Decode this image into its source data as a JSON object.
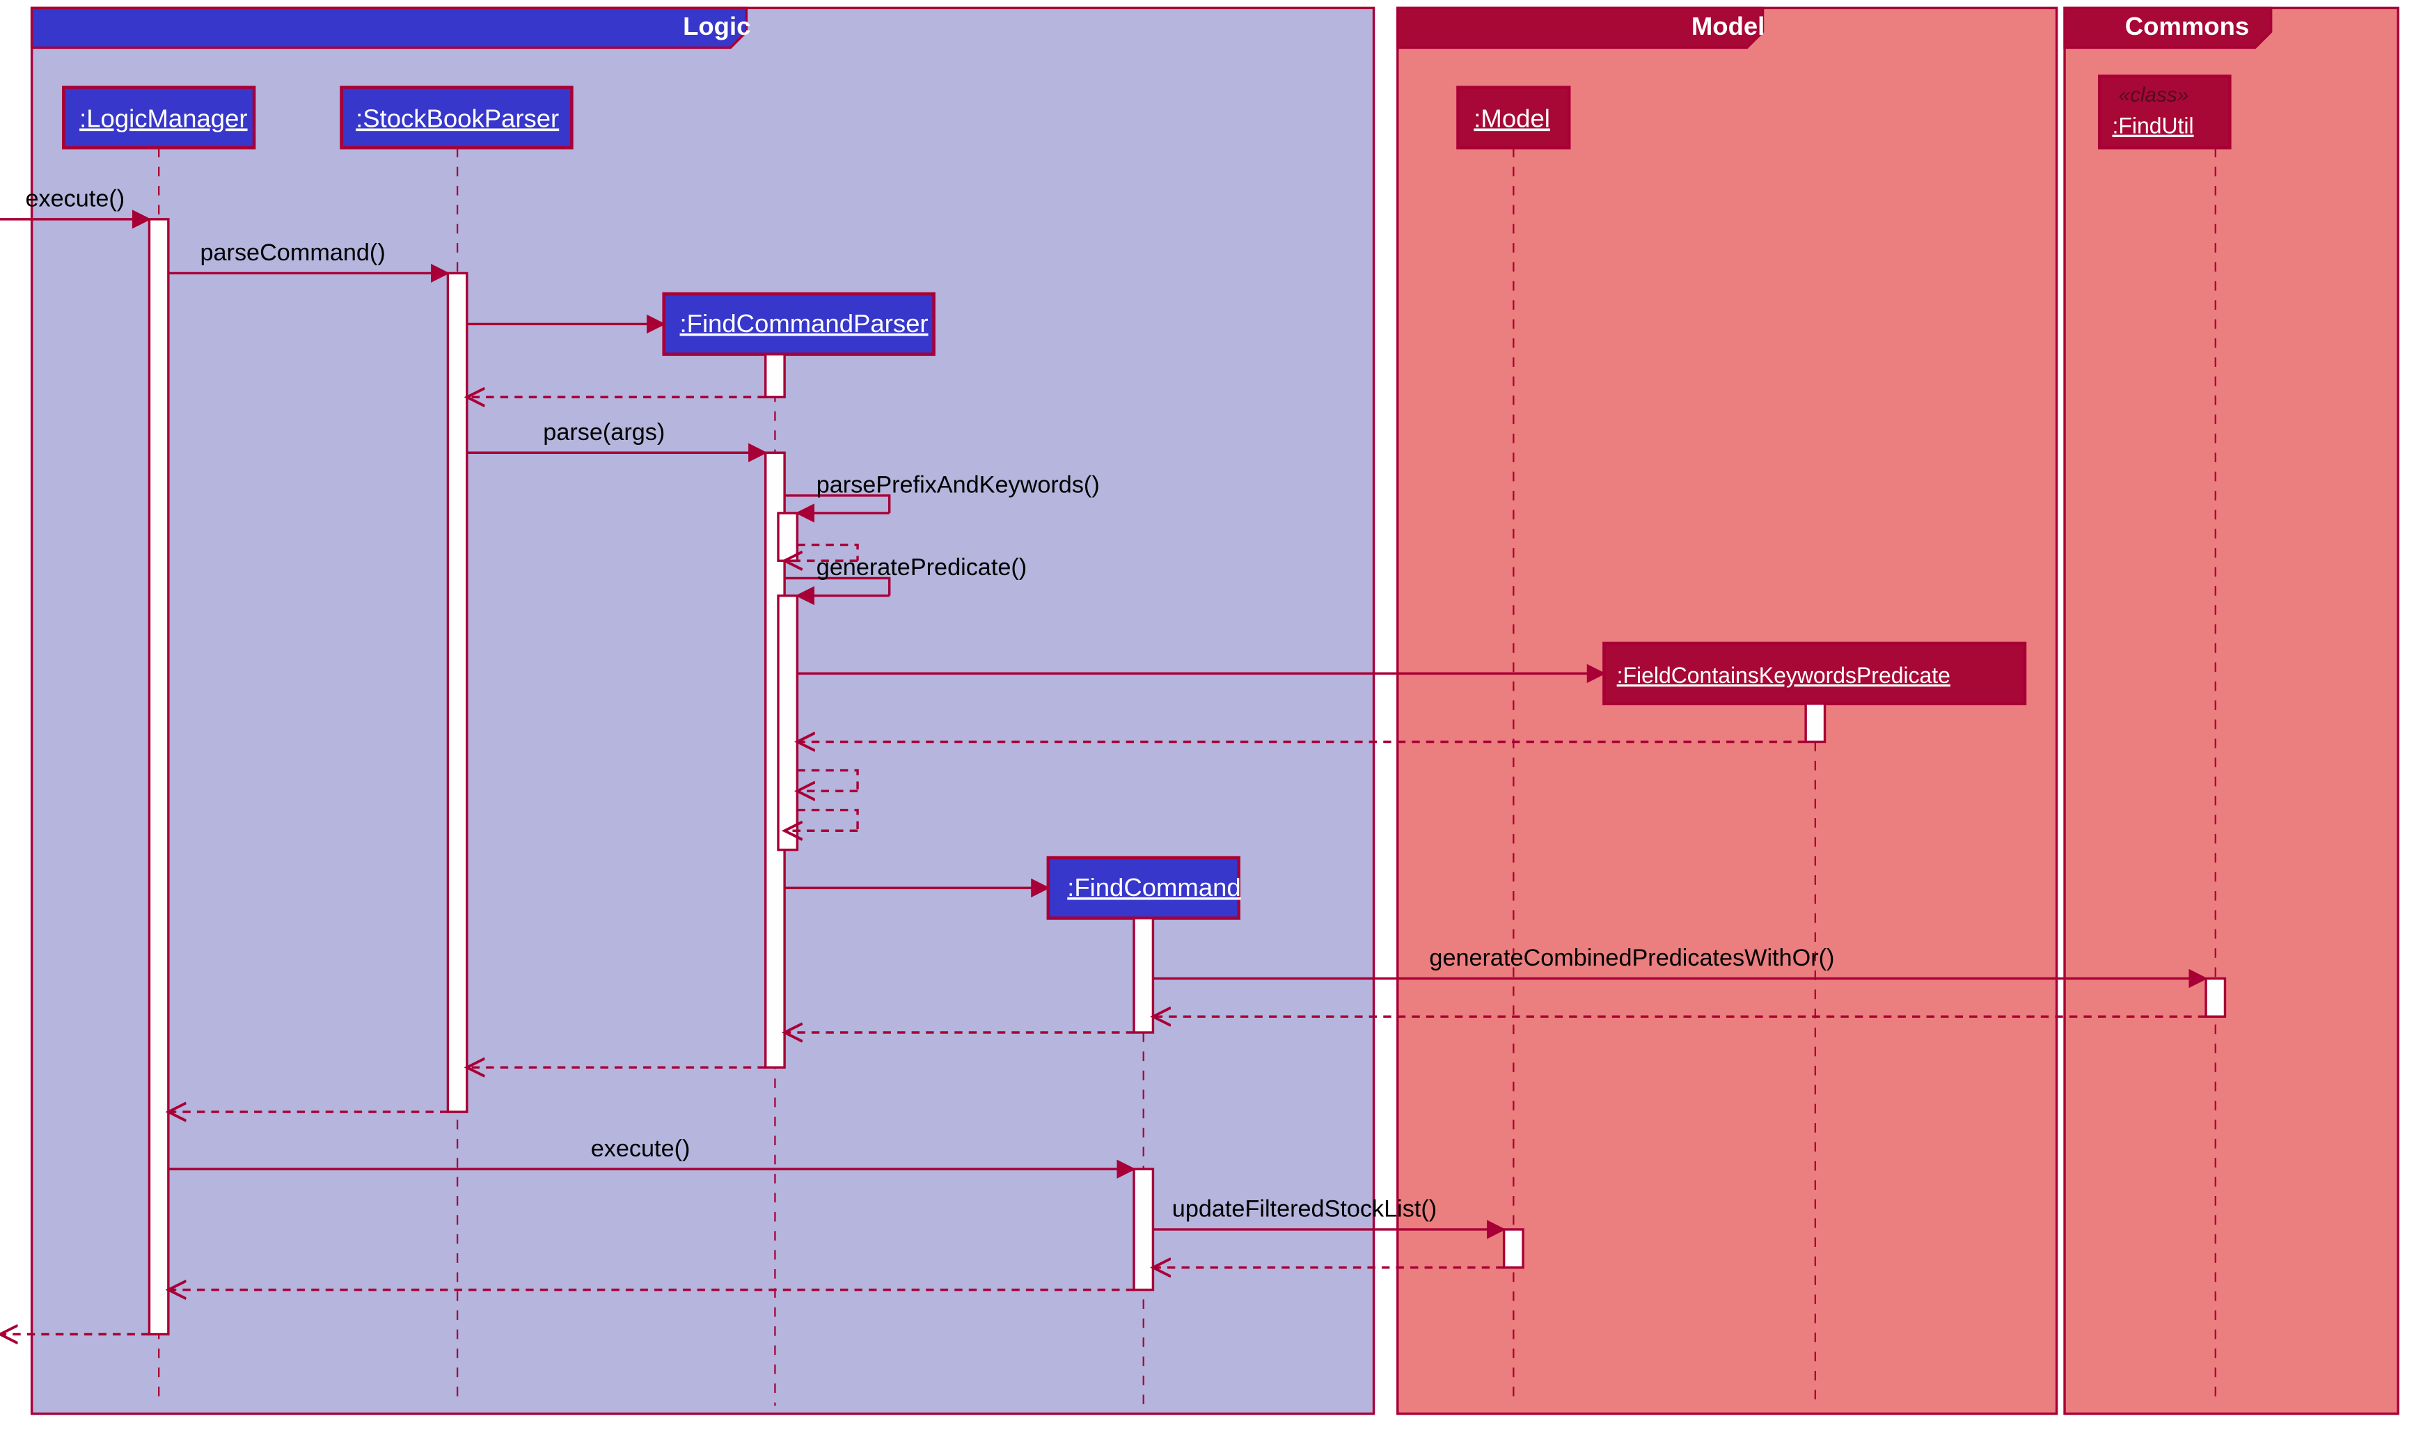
{
  "frames": {
    "logic": {
      "title": "Logic"
    },
    "model": {
      "title": "Model"
    },
    "commons": {
      "title": "Commons"
    }
  },
  "participants": {
    "logicManager": {
      "label": ":LogicManager"
    },
    "stockBookParser": {
      "label": ":StockBookParser"
    },
    "findCommandParser": {
      "label": ":FindCommandParser"
    },
    "findCommand": {
      "label": ":FindCommand"
    },
    "model": {
      "label": ":Model"
    },
    "fieldPredicate": {
      "label": ":FieldContainsKeywordsPredicate"
    },
    "findUtil": {
      "stereotype": "«class»",
      "label": ":FindUtil"
    }
  },
  "messages": {
    "execute_in": "execute()",
    "parseCommand": "parseCommand()",
    "parseArgs": "parse(args)",
    "parsePrefix": "parsePrefixAndKeywords()",
    "generatePredicate": "generatePredicate()",
    "generateCombined": "generateCombinedPredicatesWithOr()",
    "execute_cmd": "execute()",
    "updateFilteredList": "updateFilteredStockList()"
  }
}
